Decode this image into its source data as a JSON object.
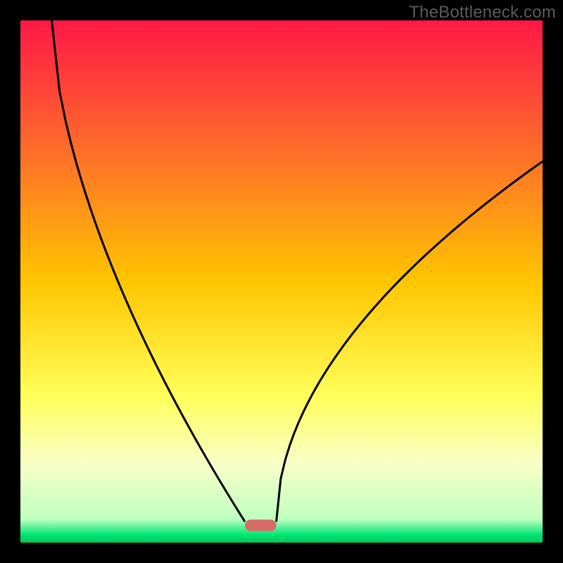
{
  "watermark": "TheBottleneck.com",
  "chart_data": {
    "type": "line",
    "title": "",
    "xlabel": "",
    "ylabel": "",
    "xlim": [
      0,
      100
    ],
    "ylim": [
      0,
      100
    ],
    "background_gradient_stops": [
      {
        "pos": 0.0,
        "color": "#ff1846"
      },
      {
        "pos": 0.25,
        "color": "#fd6d2a"
      },
      {
        "pos": 0.5,
        "color": "#ffc500"
      },
      {
        "pos": 0.72,
        "color": "#ffff5a"
      },
      {
        "pos": 0.85,
        "color": "#f8ffc8"
      },
      {
        "pos": 0.955,
        "color": "#bfffbf"
      },
      {
        "pos": 0.985,
        "color": "#00e676"
      },
      {
        "pos": 1.0,
        "color": "#00c853"
      }
    ],
    "curves": {
      "left": {
        "x_start": 6,
        "y_start": 100,
        "x_end": 43,
        "y_end": 4,
        "note": "descending concave curve from top-left to valley"
      },
      "right": {
        "x_start": 49,
        "y_start": 4,
        "x_end": 100,
        "y_end": 73,
        "note": "ascending concave curve from valley to right edge"
      }
    },
    "valley_marker": {
      "x_center": 46,
      "y": 3.3,
      "width": 6,
      "height": 2.2,
      "color": "#d96a6a",
      "rx": 8
    }
  }
}
